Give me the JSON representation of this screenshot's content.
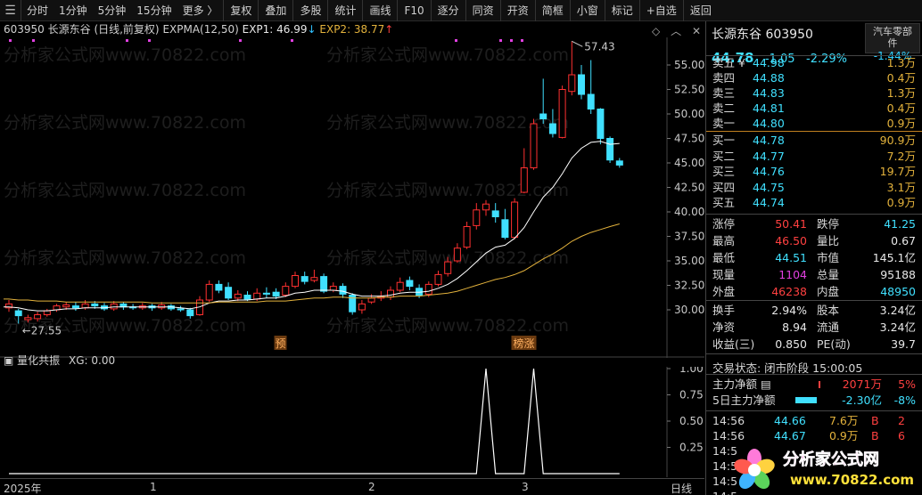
{
  "toolbar": {
    "periods": [
      "分时",
      "1分钟",
      "5分钟",
      "15分钟",
      "更多 〉"
    ],
    "buttons": [
      "复权",
      "叠加",
      "多股",
      "统计",
      "画线",
      "F10",
      "逐分",
      "同资",
      "开资",
      "简框",
      "小窗",
      "标记",
      "+自选",
      "返回"
    ]
  },
  "chart": {
    "code": "603950 长源东谷 (日线,前复权)",
    "indicator": "EXPMA(12,50)",
    "exp1_label": "EXP1: 46.99",
    "exp1_arrow": "↓",
    "exp2_label": "EXP2: 38.77",
    "exp2_arrow": "↑",
    "high_label": "57.43",
    "low_label": "27.55",
    "marker_yu": "预",
    "marker_bangzhang": "榜涨",
    "sub_indicator": "量化共振",
    "sub_value": "XG: 0.00",
    "period_label": "日线",
    "watermark": "分析家公式网www.70822.com",
    "colors": {
      "up": "#ff3030",
      "down": "#40e0ff",
      "exp1": "#ffffff",
      "exp2": "#e3b23c"
    }
  },
  "chart_data": [
    {
      "type": "candlestick",
      "title": "",
      "y_ticks": [
        "55.00",
        "52.50",
        "50.00",
        "47.50",
        "45.00",
        "42.50",
        "40.00",
        "37.50",
        "35.00",
        "32.50",
        "30.00"
      ],
      "x_ticks": [
        "2025年",
        "1",
        "2",
        "3"
      ],
      "candles": [
        {
          "o": 30.2,
          "c": 30.6,
          "h": 31.0,
          "l": 29.8
        },
        {
          "o": 29.9,
          "c": 29.4,
          "h": 30.1,
          "l": 28.6
        },
        {
          "o": 29.0,
          "c": 29.2,
          "h": 29.5,
          "l": 28.7
        },
        {
          "o": 29.1,
          "c": 29.5,
          "h": 29.8,
          "l": 28.8
        },
        {
          "o": 29.5,
          "c": 29.9,
          "h": 30.1,
          "l": 29.3
        },
        {
          "o": 30.0,
          "c": 30.4,
          "h": 30.6,
          "l": 29.8
        },
        {
          "o": 30.3,
          "c": 30.5,
          "h": 30.8,
          "l": 30.0
        },
        {
          "o": 30.4,
          "c": 30.2,
          "h": 30.8,
          "l": 29.9
        },
        {
          "o": 30.2,
          "c": 30.6,
          "h": 31.0,
          "l": 30.0
        },
        {
          "o": 30.6,
          "c": 30.4,
          "h": 30.9,
          "l": 30.1
        },
        {
          "o": 30.4,
          "c": 30.1,
          "h": 30.7,
          "l": 29.9
        },
        {
          "o": 30.1,
          "c": 30.6,
          "h": 30.9,
          "l": 29.9
        },
        {
          "o": 30.6,
          "c": 30.3,
          "h": 30.8,
          "l": 30.0
        },
        {
          "o": 30.3,
          "c": 30.2,
          "h": 30.6,
          "l": 30.0
        },
        {
          "o": 30.2,
          "c": 30.4,
          "h": 30.7,
          "l": 30.0
        },
        {
          "o": 30.4,
          "c": 30.2,
          "h": 30.6,
          "l": 29.9
        },
        {
          "o": 30.2,
          "c": 30.5,
          "h": 30.8,
          "l": 30.0
        },
        {
          "o": 30.4,
          "c": 30.1,
          "h": 30.6,
          "l": 29.9
        },
        {
          "o": 30.1,
          "c": 30.0,
          "h": 30.4,
          "l": 29.8
        },
        {
          "o": 30.0,
          "c": 29.4,
          "h": 30.2,
          "l": 29.1
        },
        {
          "o": 29.5,
          "c": 31.0,
          "h": 31.4,
          "l": 29.4
        },
        {
          "o": 31.0,
          "c": 32.6,
          "h": 33.0,
          "l": 30.8
        },
        {
          "o": 32.6,
          "c": 32.0,
          "h": 33.0,
          "l": 31.7
        },
        {
          "o": 32.3,
          "c": 31.2,
          "h": 32.8,
          "l": 31.0
        },
        {
          "o": 31.2,
          "c": 31.6,
          "h": 32.0,
          "l": 30.9
        },
        {
          "o": 31.5,
          "c": 31.1,
          "h": 31.9,
          "l": 30.9
        },
        {
          "o": 31.1,
          "c": 31.7,
          "h": 32.2,
          "l": 30.9
        },
        {
          "o": 31.7,
          "c": 31.6,
          "h": 32.3,
          "l": 31.2
        },
        {
          "o": 31.8,
          "c": 31.4,
          "h": 32.2,
          "l": 31.1
        },
        {
          "o": 31.5,
          "c": 32.4,
          "h": 32.8,
          "l": 31.3
        },
        {
          "o": 32.4,
          "c": 33.5,
          "h": 33.9,
          "l": 32.2
        },
        {
          "o": 33.4,
          "c": 32.9,
          "h": 33.9,
          "l": 32.6
        },
        {
          "o": 33.0,
          "c": 33.3,
          "h": 34.1,
          "l": 32.8
        },
        {
          "o": 33.4,
          "c": 31.9,
          "h": 33.7,
          "l": 31.7
        },
        {
          "o": 32.0,
          "c": 32.4,
          "h": 32.8,
          "l": 31.8
        },
        {
          "o": 32.4,
          "c": 31.6,
          "h": 32.7,
          "l": 31.2
        },
        {
          "o": 31.5,
          "c": 29.8,
          "h": 31.7,
          "l": 29.5
        },
        {
          "o": 30.0,
          "c": 30.6,
          "h": 31.0,
          "l": 29.6
        },
        {
          "o": 30.8,
          "c": 31.2,
          "h": 31.6,
          "l": 30.6
        },
        {
          "o": 31.2,
          "c": 31.4,
          "h": 31.9,
          "l": 30.9
        },
        {
          "o": 31.3,
          "c": 32.0,
          "h": 32.4,
          "l": 31.0
        },
        {
          "o": 32.0,
          "c": 32.8,
          "h": 33.3,
          "l": 31.8
        },
        {
          "o": 33.0,
          "c": 32.4,
          "h": 33.4,
          "l": 32.0
        },
        {
          "o": 32.2,
          "c": 31.5,
          "h": 32.6,
          "l": 31.2
        },
        {
          "o": 31.6,
          "c": 32.6,
          "h": 32.9,
          "l": 31.3
        },
        {
          "o": 32.6,
          "c": 33.6,
          "h": 34.0,
          "l": 32.4
        },
        {
          "o": 33.7,
          "c": 34.9,
          "h": 35.4,
          "l": 33.4
        },
        {
          "o": 35.0,
          "c": 36.3,
          "h": 36.8,
          "l": 34.8
        },
        {
          "o": 36.4,
          "c": 38.5,
          "h": 39.0,
          "l": 36.2
        },
        {
          "o": 38.6,
          "c": 40.2,
          "h": 40.9,
          "l": 38.2
        },
        {
          "o": 40.2,
          "c": 40.8,
          "h": 41.2,
          "l": 39.6
        },
        {
          "o": 40.1,
          "c": 39.5,
          "h": 40.9,
          "l": 38.9
        },
        {
          "o": 39.2,
          "c": 37.4,
          "h": 40.3,
          "l": 37.2
        },
        {
          "o": 37.4,
          "c": 41.0,
          "h": 41.4,
          "l": 37.2
        },
        {
          "o": 42.0,
          "c": 44.5,
          "h": 46.5,
          "l": 41.9
        },
        {
          "o": 44.5,
          "c": 49.0,
          "h": 49.5,
          "l": 44.3
        },
        {
          "o": 50.0,
          "c": 49.5,
          "h": 53.6,
          "l": 49.0
        },
        {
          "o": 49.0,
          "c": 48.0,
          "h": 50.5,
          "l": 47.6
        },
        {
          "o": 47.6,
          "c": 52.5,
          "h": 52.9,
          "l": 47.5
        },
        {
          "o": 52.3,
          "c": 54.0,
          "h": 57.43,
          "l": 51.9
        },
        {
          "o": 54.0,
          "c": 52.0,
          "h": 55.0,
          "l": 51.5
        },
        {
          "o": 52.0,
          "c": 50.5,
          "h": 55.5,
          "l": 50.0
        },
        {
          "o": 50.5,
          "c": 47.5,
          "h": 50.6,
          "l": 46.9
        },
        {
          "o": 47.5,
          "c": 45.3,
          "h": 47.7,
          "l": 45.0
        },
        {
          "o": 45.2,
          "c": 44.78,
          "h": 45.5,
          "l": 44.51
        }
      ],
      "series": [
        {
          "name": "EXP1",
          "values": [
            30.3,
            30.2,
            30.0,
            29.9,
            29.9,
            30.0,
            30.1,
            30.1,
            30.2,
            30.2,
            30.2,
            30.3,
            30.3,
            30.3,
            30.3,
            30.3,
            30.3,
            30.3,
            30.2,
            30.1,
            30.3,
            30.7,
            30.9,
            30.9,
            31.0,
            31.0,
            31.1,
            31.2,
            31.2,
            31.4,
            31.7,
            31.8,
            32.0,
            32.0,
            32.0,
            31.9,
            31.6,
            31.4,
            31.4,
            31.4,
            31.5,
            31.7,
            31.8,
            31.8,
            31.9,
            32.2,
            32.6,
            33.2,
            34.0,
            34.9,
            35.8,
            36.4,
            36.6,
            37.3,
            38.4,
            40.0,
            41.5,
            42.5,
            43.9,
            45.5,
            46.5,
            47.1,
            47.2,
            46.9,
            46.99
          ]
        },
        {
          "name": "EXP2",
          "values": [
            31.1,
            31.0,
            31.0,
            30.9,
            30.9,
            30.9,
            30.8,
            30.8,
            30.8,
            30.8,
            30.8,
            30.8,
            30.8,
            30.8,
            30.8,
            30.7,
            30.7,
            30.7,
            30.7,
            30.7,
            30.7,
            30.7,
            30.8,
            30.8,
            30.8,
            30.8,
            30.8,
            30.9,
            30.9,
            30.9,
            31.0,
            31.1,
            31.2,
            31.2,
            31.3,
            31.3,
            31.2,
            31.2,
            31.2,
            31.3,
            31.3,
            31.4,
            31.4,
            31.4,
            31.5,
            31.6,
            31.7,
            31.9,
            32.2,
            32.5,
            32.8,
            33.1,
            33.3,
            33.6,
            34.0,
            34.6,
            35.2,
            35.7,
            36.3,
            37.0,
            37.5,
            37.9,
            38.2,
            38.5,
            38.77
          ]
        }
      ],
      "marker_yu_index": 25,
      "marker_bangzhang_index": 55
    },
    {
      "type": "line",
      "title": "",
      "y_ticks": [
        "1.00",
        "0.75",
        "0.50",
        "0.25"
      ],
      "series": [
        {
          "name": "XG",
          "values": [
            0,
            0,
            0,
            0,
            0,
            0,
            0,
            0,
            0,
            0,
            0,
            0,
            0,
            0,
            0,
            0,
            0,
            0,
            0,
            0,
            0,
            0,
            0,
            0,
            0,
            0,
            0,
            0,
            0,
            0,
            0,
            0,
            0,
            0,
            0,
            0,
            0,
            0,
            0,
            0,
            0,
            0,
            0,
            0,
            0,
            0,
            0,
            0,
            0,
            0,
            1,
            0,
            0,
            0,
            0,
            1,
            0,
            0,
            0,
            0,
            0,
            0,
            0,
            0,
            0
          ]
        }
      ]
    }
  ],
  "quote": {
    "name": "长源东谷 603950",
    "price": "44.78",
    "change": "-1.05",
    "change_pct": "-2.29%",
    "sector_line1": "汽车零部",
    "sector_line2": "件",
    "sector_pct": "-1.44%",
    "asks": [
      {
        "label": "卖五 ¥",
        "price": "44.98",
        "vol": "1.3万"
      },
      {
        "label": "卖四",
        "price": "44.88",
        "vol": "0.4万"
      },
      {
        "label": "卖三",
        "price": "44.83",
        "vol": "1.3万"
      },
      {
        "label": "卖二",
        "price": "44.81",
        "vol": "0.4万"
      },
      {
        "label": "卖一",
        "price": "44.80",
        "vol": "0.9万"
      }
    ],
    "bids": [
      {
        "label": "买一",
        "price": "44.78",
        "vol": "90.9万"
      },
      {
        "label": "买二",
        "price": "44.77",
        "vol": "7.2万"
      },
      {
        "label": "买三",
        "price": "44.76",
        "vol": "19.7万"
      },
      {
        "label": "买四",
        "price": "44.75",
        "vol": "3.1万"
      },
      {
        "label": "买五",
        "price": "44.74",
        "vol": "0.9万"
      }
    ],
    "stats1": [
      {
        "l1": "涨停",
        "v1": "50.41",
        "l2": "跌停",
        "v2": "41.25"
      },
      {
        "l1": "最高",
        "v1": "46.50",
        "l2": "量比",
        "v2": "0.67"
      },
      {
        "l1": "最低",
        "v1": "44.51",
        "l2": "市值",
        "v2": "145.1亿"
      },
      {
        "l1": "现量",
        "v1": "1104",
        "l2": "总量",
        "v2": "95188"
      },
      {
        "l1": "外盘",
        "v1": "46238",
        "l2": "内盘",
        "v2": "48950"
      }
    ],
    "stats2": [
      {
        "l1": "换手",
        "v1": "2.94%",
        "l2": "股本",
        "v2": "3.24亿"
      },
      {
        "l1": "净资",
        "v1": "8.94",
        "l2": "流通",
        "v2": "3.24亿"
      },
      {
        "l1": "收益(三)",
        "v1": "0.850",
        "l2": "PE(动)",
        "v2": "39.7"
      }
    ],
    "trade_status": "交易状态: 闭市阶段 15:00:05",
    "flows": [
      {
        "label": "主力净额 ▤",
        "amount": "2071万",
        "pct": "5%"
      },
      {
        "label": "5日主力净额",
        "amount": "-2.30亿",
        "pct": "-8%"
      }
    ],
    "ticks": [
      {
        "time": "14:56",
        "price": "44.66",
        "vol": "7.6万",
        "bs": "B",
        "n": "2"
      },
      {
        "time": "14:56",
        "price": "44.67",
        "vol": "0.9万",
        "bs": "B",
        "n": "6"
      },
      {
        "time": "14:5",
        "price": "",
        "vol": "",
        "bs": "",
        "n": ""
      },
      {
        "time": "14:5",
        "price": "",
        "vol": "",
        "bs": "",
        "n": ""
      },
      {
        "time": "14:5",
        "price": "",
        "vol": "",
        "bs": "",
        "n": ""
      },
      {
        "time": "14:5",
        "price": "",
        "vol": "",
        "bs": "",
        "n": ""
      }
    ],
    "logo_text": "分析家公式网",
    "logo_url": "www.70822.com"
  }
}
